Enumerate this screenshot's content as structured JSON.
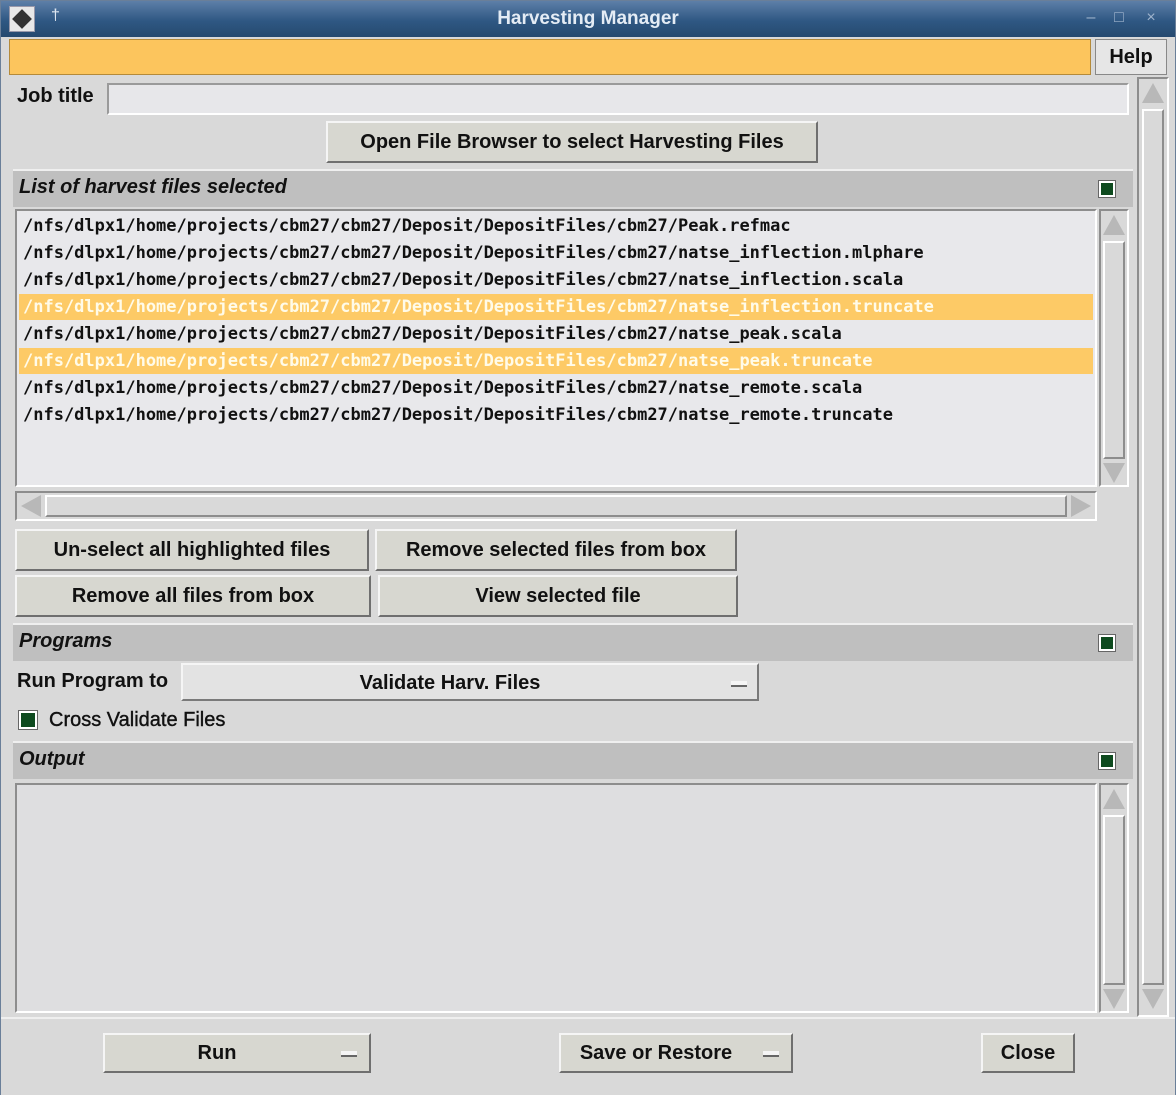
{
  "window": {
    "title": "Harvesting Manager"
  },
  "menubar": {
    "help_label": "Help"
  },
  "job": {
    "label": "Job title",
    "value": ""
  },
  "browse_button": "Open File Browser to select Harvesting Files",
  "files_section": {
    "title": "List of harvest files selected",
    "files": [
      {
        "path": "/nfs/dlpx1/home/projects/cbm27/cbm27/Deposit/DepositFiles/cbm27/Peak.refmac",
        "selected": false
      },
      {
        "path": "/nfs/dlpx1/home/projects/cbm27/cbm27/Deposit/DepositFiles/cbm27/natse_inflection.mlphare",
        "selected": false
      },
      {
        "path": "/nfs/dlpx1/home/projects/cbm27/cbm27/Deposit/DepositFiles/cbm27/natse_inflection.scala",
        "selected": false
      },
      {
        "path": "/nfs/dlpx1/home/projects/cbm27/cbm27/Deposit/DepositFiles/cbm27/natse_inflection.truncate",
        "selected": true
      },
      {
        "path": "/nfs/dlpx1/home/projects/cbm27/cbm27/Deposit/DepositFiles/cbm27/natse_peak.scala",
        "selected": false
      },
      {
        "path": "/nfs/dlpx1/home/projects/cbm27/cbm27/Deposit/DepositFiles/cbm27/natse_peak.truncate",
        "selected": true
      },
      {
        "path": "/nfs/dlpx1/home/projects/cbm27/cbm27/Deposit/DepositFiles/cbm27/natse_remote.scala",
        "selected": false
      },
      {
        "path": "/nfs/dlpx1/home/projects/cbm27/cbm27/Deposit/DepositFiles/cbm27/natse_remote.truncate",
        "selected": false
      }
    ],
    "unselect_button": "Un-select all highlighted files",
    "remove_selected_button": "Remove selected files from box",
    "remove_all_button": "Remove all files from box",
    "view_button": "View selected file"
  },
  "programs_section": {
    "title": "Programs",
    "run_program_label": "Run Program to",
    "run_program_value": "Validate Harv. Files",
    "cross_validate_label": "Cross Validate Files",
    "cross_validate_checked": true
  },
  "output_section": {
    "title": "Output",
    "text": ""
  },
  "footer": {
    "run_label": "Run",
    "save_restore_label": "Save or Restore",
    "close_label": "Close"
  },
  "colors": {
    "menubar": "#fcc55d",
    "highlight": "#fdca66",
    "titlebar": "#2f5883",
    "indicator": "#0d4a1e"
  }
}
